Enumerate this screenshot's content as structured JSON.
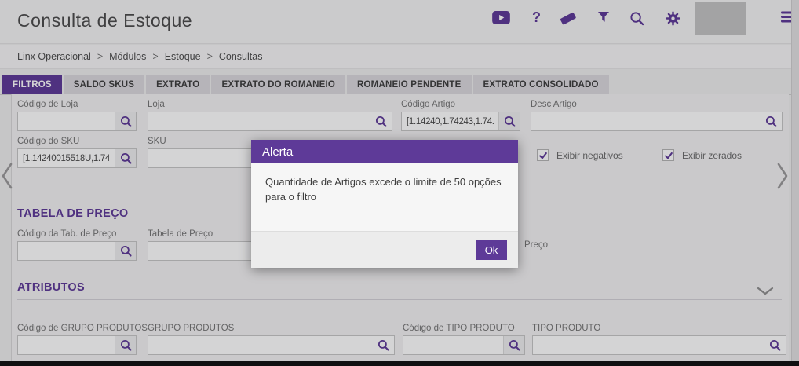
{
  "colors": {
    "purple": "#5e3a98"
  },
  "header": {
    "title": "Consulta de Estoque",
    "icons": [
      "youtube-icon",
      "help-icon",
      "eraser-icon",
      "filter-icon",
      "search-icon",
      "settings-gear-icon",
      "menu-icon"
    ]
  },
  "breadcrumb": {
    "separator": ">",
    "items": [
      "Linx Operacional",
      "Módulos",
      "Estoque",
      "Consultas"
    ]
  },
  "tabs": [
    {
      "label": "FILTROS",
      "active": true
    },
    {
      "label": "SALDO SKUS",
      "active": false
    },
    {
      "label": "EXTRATO",
      "active": false
    },
    {
      "label": "EXTRATO DO ROMANEIO",
      "active": false
    },
    {
      "label": "ROMANEIO PENDENTE",
      "active": false
    },
    {
      "label": "EXTRATO CONSOLIDADO",
      "active": false
    }
  ],
  "filters": {
    "row1": [
      {
        "label": "Código de Loja",
        "value": ""
      },
      {
        "label": "Loja",
        "value": ""
      },
      {
        "label": "Código Artigo",
        "value": "[1.14240,1.74243,1.74..."
      },
      {
        "label": "Desc Artigo",
        "value": ""
      }
    ],
    "row2": [
      {
        "label": "Código do SKU",
        "value": "[1.14240015518U,1.74..."
      },
      {
        "label": "SKU",
        "value": ""
      }
    ],
    "checkboxes": [
      {
        "label": "Exibir negativos",
        "checked": true
      },
      {
        "label": "Exibir zerados",
        "checked": true
      }
    ]
  },
  "price": {
    "title": "TABELA DE PREÇO",
    "fields": [
      {
        "label": "Código da Tab. de Preço",
        "value": ""
      },
      {
        "label": "Tabela de Preço",
        "value": ""
      }
    ],
    "partial_label": "Preço"
  },
  "attributes": {
    "title": "ATRIBUTOS",
    "fields": [
      {
        "label": "Código de GRUPO PRODUTOS",
        "value": ""
      },
      {
        "label": "GRUPO PRODUTOS",
        "value": ""
      },
      {
        "label": "Código de TIPO PRODUTO",
        "value": ""
      },
      {
        "label": "TIPO PRODUTO",
        "value": ""
      }
    ]
  },
  "modal": {
    "title": "Alerta",
    "message": "Quantidade de Artigos excede o limite de 50 opções para o filtro",
    "ok_label": "Ok"
  }
}
